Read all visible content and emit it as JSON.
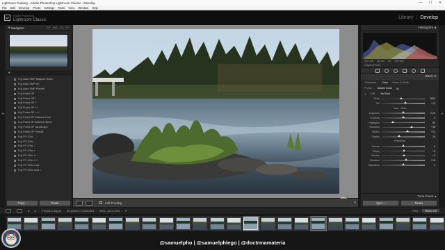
{
  "window": {
    "title": "Lightroom Catalog - Adobe Photoshop Lightroom Classic - Develop",
    "controls": [
      "—",
      "☐",
      "✕"
    ]
  },
  "menu": [
    "File",
    "Edit",
    "Develop",
    "Photo",
    "Settings",
    "Tools",
    "View",
    "Window",
    "Help"
  ],
  "identity": {
    "logo": "Lr",
    "sub": "Adobe Photoshop",
    "app": "Lightroom Classic",
    "modules": [
      "Library",
      "Develop"
    ],
    "active_module": "Develop"
  },
  "left_panel": {
    "navigator": {
      "title": "Navigator",
      "options": [
        "FIT",
        "FILL",
        "1:1",
        "3:1"
      ]
    },
    "presets": [
      "Fuji Astia SMP Balance Warm",
      "Fuji Astia SMP HC",
      "Fuji Astia SMP Portrait",
      "Fuji Portra 3P",
      "Fuji Portra 3P+",
      "Fuji Portra 3P +",
      "Fuji Portra 3P ++",
      "Fuji Portra 3P +++",
      "Fuji Portra 3P Balance Cool",
      "Fuji Portra 3P Balance Warm",
      "Fuji Portra 3P Landscape",
      "Fuji Portra 3P Portrait",
      "Fuji FP-100c",
      "Fuji FP-100c -",
      "Fuji FP-100c --",
      "Fuji FP-100c +",
      "Fuji FP-100c ++",
      "Fuji FP-100c +++",
      "Fuji FP-100c Cool",
      "Fuji FP-100c Cool +"
    ],
    "buttons": {
      "copy": "Copy...",
      "paste": "Paste"
    }
  },
  "toolbar": {
    "soft_proofing": "Soft Proofing"
  },
  "right_panel": {
    "histogram_title": "Histogram",
    "hist_meta": [
      "ISO 100",
      "18 mm",
      "f/8",
      "1/60 sec"
    ],
    "original_photo": "Original Photo",
    "basic_title": "Basic",
    "treatment": {
      "label": "Treatment :",
      "options": [
        "Color",
        "Black & White"
      ],
      "selected": "Color"
    },
    "profile": {
      "label": "Profile :",
      "value": "Adobe Color"
    },
    "wb": {
      "label": "WB :",
      "value": "As Shot"
    },
    "wb_sliders": [
      {
        "label": "Temp",
        "value": "4850",
        "pos": 0.45
      },
      {
        "label": "Tint",
        "value": "+13",
        "pos": 0.55
      }
    ],
    "tone_label": "Tone",
    "tone_auto": "Auto",
    "tone_sliders": [
      {
        "label": "Exposure",
        "value": "0.00",
        "pos": 0.5
      },
      {
        "label": "Contrast",
        "value": "0",
        "pos": 0.5
      },
      {
        "label": "Highlights",
        "value": "-55",
        "pos": 0.25
      },
      {
        "label": "Shadows",
        "value": "+48",
        "pos": 0.7
      },
      {
        "label": "Whites",
        "value": "+22",
        "pos": 0.6
      },
      {
        "label": "Blacks",
        "value": "-18",
        "pos": 0.4
      }
    ],
    "presence_label": "Presence",
    "presence_sliders": [
      {
        "label": "Texture",
        "value": "0",
        "pos": 0.5
      },
      {
        "label": "Clarity",
        "value": "+5",
        "pos": 0.52
      },
      {
        "label": "Dehaze",
        "value": "+3",
        "pos": 0.51
      },
      {
        "label": "Vibrance",
        "value": "+15",
        "pos": 0.56
      },
      {
        "label": "Saturation",
        "value": "0",
        "pos": 0.5
      }
    ],
    "tone_curve": "Tone Curve",
    "buttons": {
      "sync": "Sync...",
      "reset": "Reset"
    }
  },
  "filmstrip_bar": {
    "source": "Previous Import",
    "count": "30 photos / 1 selected",
    "filename": "/IMG_1674.CR3",
    "filter_label": "Filter :",
    "filter_value": "Filters Off"
  },
  "watermark": "@samuelpho | @samuelphlego | @doctrmamateria"
}
